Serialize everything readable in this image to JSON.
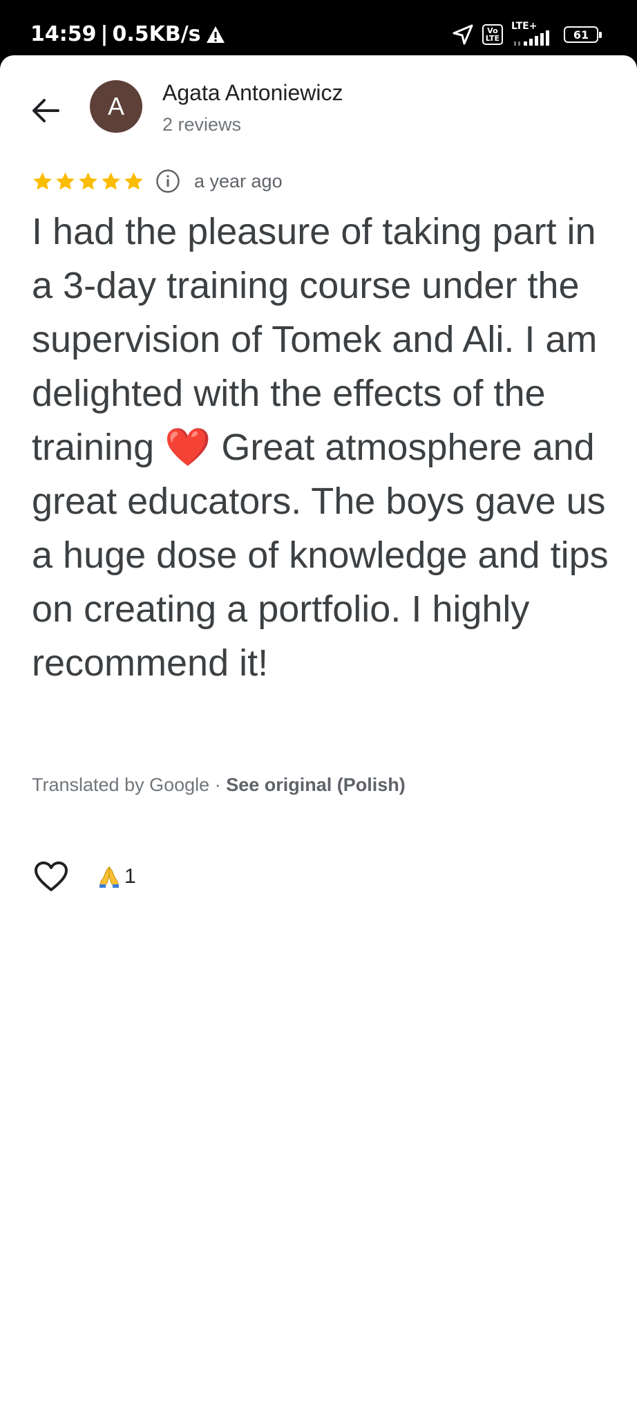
{
  "status_bar": {
    "time": "14:59",
    "separator": "|",
    "speed": "0.5KB/s",
    "volte_top": "Vo",
    "volte_bottom": "LTE",
    "network": "LTE+",
    "battery": "61",
    "icons": [
      "warning-icon",
      "location-arrow-icon",
      "volte-icon",
      "signal-icon",
      "battery-icon"
    ]
  },
  "header": {
    "back_icon": "arrow-left-icon",
    "avatar_letter": "A",
    "avatar_color": "#5d4037",
    "author_name": "Agata Antoniewicz",
    "review_count": "2 reviews"
  },
  "review": {
    "rating": 5,
    "star_color": "#fbbc04",
    "info_icon": "info-circle-icon",
    "time": "a year ago",
    "text": "I had the pleasure of taking part in a 3-day training course under the supervision of Tomek and Ali. I am delighted with the effects of the training ❤️ Great atmosphere and great educators. The boys gave us a huge dose of knowledge and tips on creating a portfolio. I highly recommend it!",
    "translated_by": "Translated by Google",
    "dot": "·",
    "see_original": "See original (Polish)"
  },
  "reactions": {
    "like_icon": "heart-outline-icon",
    "reaction_emoji_icon": "folded-hands-icon",
    "reaction_count": "1"
  }
}
